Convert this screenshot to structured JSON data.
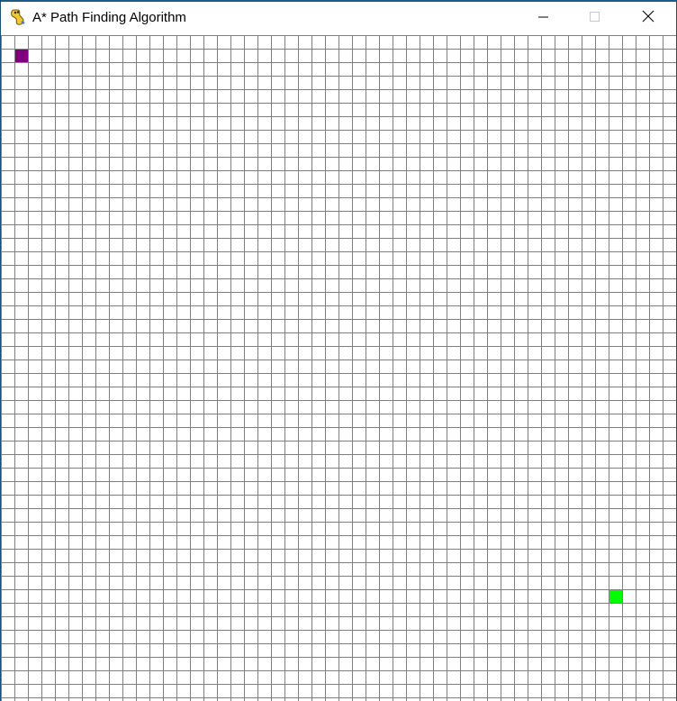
{
  "window": {
    "title": "A* Path Finding Algorithm",
    "icon": "pygame-snake-icon",
    "controls": {
      "minimize_icon": "minimize-icon",
      "maximize_icon": "maximize-icon",
      "close_icon": "close-icon"
    }
  },
  "grid": {
    "rows": 50,
    "cols": 50,
    "background_color": "#ffffff",
    "line_color": "#808080",
    "start_node": {
      "row": 1,
      "col": 1,
      "color": "#800080"
    },
    "end_node": {
      "row": 41,
      "col": 45,
      "color": "#00ff00"
    }
  }
}
